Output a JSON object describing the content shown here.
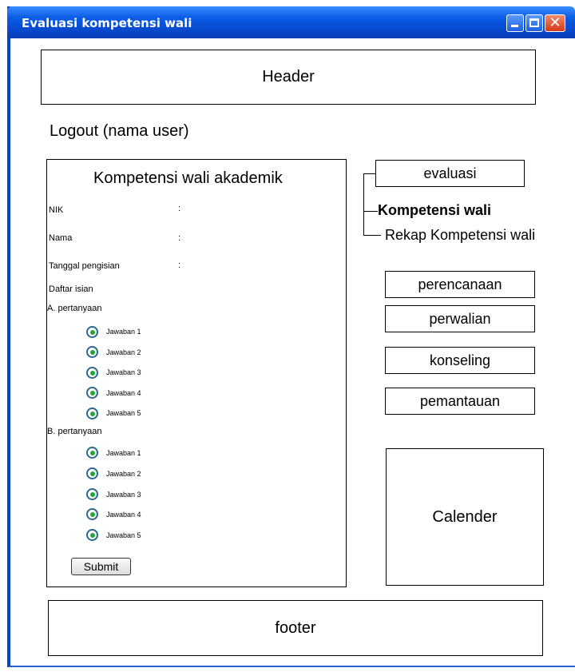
{
  "window": {
    "title": "Evaluasi kompetensi wali"
  },
  "header": {
    "label": "Header"
  },
  "logout": {
    "label": "Logout (nama user)"
  },
  "form": {
    "title": "Kompetensi wali akademik",
    "fields": [
      {
        "label": "NIK",
        "sep": ":"
      },
      {
        "label": "Nama",
        "sep": ":"
      },
      {
        "label": "Tanggal pengisian",
        "sep": ":"
      }
    ],
    "list_title": "Daftar isian",
    "sections": [
      {
        "title": "A. pertanyaan",
        "answers": [
          "Jawaban 1",
          "Jawaban 2",
          "Jawaban 3",
          "Jawaban 4",
          "Jawaban 5"
        ]
      },
      {
        "title": "B. pertanyaan",
        "answers": [
          "Jawaban 1",
          "Jawaban 2",
          "Jawaban 3",
          "Jawaban 4",
          "Jawaban 5"
        ]
      }
    ],
    "submit": "Submit"
  },
  "nav": {
    "evaluasi": "evaluasi",
    "kompetensi": "Kompetensi wali",
    "rekap": "Rekap Kompetensi wali",
    "perencanaan": "perencanaan",
    "perwalian": "perwalian",
    "konseling": "konseling",
    "pemantauan": "pemantauan"
  },
  "calendar": {
    "label": "Calender"
  },
  "footer": {
    "label": "footer"
  }
}
